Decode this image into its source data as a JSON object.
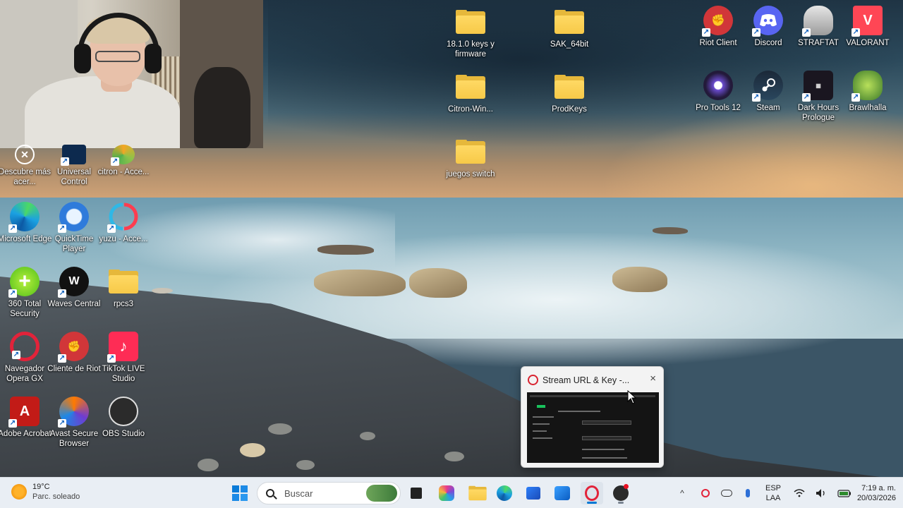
{
  "webcam": {
    "label": "webcam overlay"
  },
  "desktop": {
    "left_icons": [
      {
        "name": "Descubre más acer...",
        "icon": "acer-icon"
      },
      {
        "name": "Universal Control",
        "icon": "universal-control-icon"
      },
      {
        "name": "citron - Acce...",
        "icon": "citron-icon"
      },
      {
        "name": "Microsoft Edge",
        "icon": "edge-icon"
      },
      {
        "name": "QuickTime Player",
        "icon": "quicktime-icon"
      },
      {
        "name": "yuzu - Acce...",
        "icon": "yuzu-icon"
      },
      {
        "name": "360 Total Security",
        "icon": "360-security-icon"
      },
      {
        "name": "Waves Central",
        "icon": "waves-icon"
      },
      {
        "name": "rpcs3",
        "icon": "folder-icon"
      },
      {
        "name": "Navegador Opera GX",
        "icon": "opera-gx-icon"
      },
      {
        "name": "Cliente de Riot",
        "icon": "riot-icon"
      },
      {
        "name": "TikTok LIVE Studio",
        "icon": "tiktok-icon"
      },
      {
        "name": "Adobe Acrobat",
        "icon": "acrobat-icon"
      },
      {
        "name": "Avast Secure Browser",
        "icon": "avast-icon"
      },
      {
        "name": "OBS Studio",
        "icon": "obs-icon"
      }
    ],
    "center_icons": [
      {
        "name": "18.1.0 keys y firmware",
        "icon": "folder-icon"
      },
      {
        "name": "SAK_64bit",
        "icon": "folder-icon"
      },
      {
        "name": "Citron-Win...",
        "icon": "folder-icon"
      },
      {
        "name": "ProdKeys",
        "icon": "folder-icon"
      },
      {
        "name": "juegos switch",
        "icon": "folder-icon"
      }
    ],
    "right_icons": [
      {
        "name": "Riot Client",
        "icon": "riot-icon"
      },
      {
        "name": "Discord",
        "icon": "discord-icon"
      },
      {
        "name": "STRAFTAT",
        "icon": "straftat-icon"
      },
      {
        "name": "VALORANT",
        "icon": "valorant-icon"
      },
      {
        "name": "Pro Tools 12",
        "icon": "protools-icon"
      },
      {
        "name": "Steam",
        "icon": "steam-icon"
      },
      {
        "name": "Dark Hours Prologue",
        "icon": "dark-hours-icon"
      },
      {
        "name": "Brawlhalla",
        "icon": "brawlhalla-icon"
      }
    ]
  },
  "preview": {
    "title": "Stream URL & Key -...",
    "close": "×",
    "app_icon": "opera-icon"
  },
  "taskbar": {
    "weather": {
      "temp": "19°C",
      "condition": "Parc. soleado"
    },
    "search_placeholder": "Buscar",
    "tray": {
      "language": "ESP",
      "layout": "LAA",
      "time": "7:19 a. m.",
      "date": "20/03/2026"
    },
    "colors": {
      "taskbar_bg": "#e9eef4",
      "accent": "#0078d4"
    }
  }
}
